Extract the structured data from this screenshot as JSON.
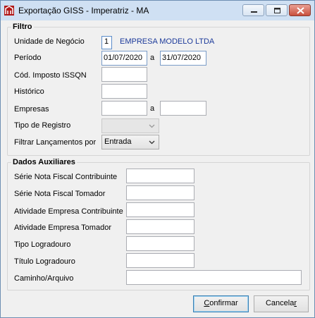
{
  "window": {
    "title": "Exportação GISS - Imperatriz - MA"
  },
  "filtro": {
    "legend": "Filtro",
    "unidade_label": "Unidade de Negócio",
    "unidade_code": "1",
    "unidade_name": "EMPRESA MODELO LTDA",
    "periodo_label": "Período",
    "periodo_inicio": "01/07/2020",
    "a1": "a",
    "periodo_fim": "31/07/2020",
    "cod_imposto_label": "Cód. Imposto ISSQN",
    "cod_imposto_value": "",
    "historico_label": "Histórico",
    "historico_value": "",
    "empresas_label": "Empresas",
    "empresas_de": "",
    "a2": "a",
    "empresas_ate": "",
    "tipo_registro_label": "Tipo de Registro",
    "tipo_registro_value": "",
    "filtrar_label": "Filtrar Lançamentos por",
    "filtrar_value": "Entrada"
  },
  "dados": {
    "legend": "Dados Auxiliares",
    "serie_contrib_label": "Série Nota Fiscal Contribuinte",
    "serie_contrib_value": "",
    "serie_tomador_label": "Série Nota Fiscal Tomador",
    "serie_tomador_value": "",
    "atividade_contrib_label": "Atividade Empresa Contribuinte",
    "atividade_contrib_value": "",
    "atividade_tomador_label": "Atividade Empresa Tomador",
    "atividade_tomador_value": "",
    "tipo_logradouro_label": "Tipo Logradouro",
    "tipo_logradouro_value": "",
    "titulo_logradouro_label": "Título Logradouro",
    "titulo_logradouro_value": "",
    "caminho_label": "Caminho/Arquivo",
    "caminho_value": ""
  },
  "buttons": {
    "confirmar_u": "C",
    "confirmar_rest": "onfirmar",
    "cancelar_main": "Cancela",
    "cancelar_u": "r"
  }
}
